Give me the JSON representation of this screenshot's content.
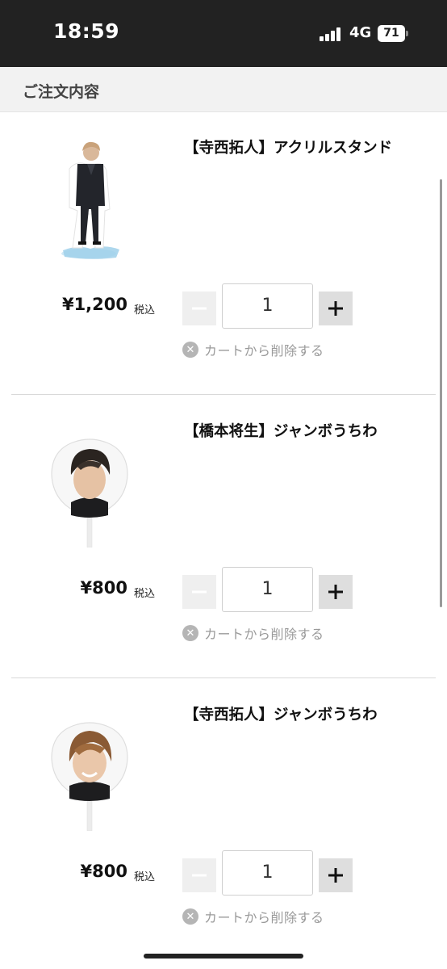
{
  "status_bar": {
    "time": "18:59",
    "network": "4G",
    "battery": "71",
    "icons": [
      "signal-icon",
      "battery-icon"
    ]
  },
  "header": {
    "title": "ご注文内容"
  },
  "items": [
    {
      "name": "【寺西拓人】アクリルスタンド",
      "price": "¥1,200",
      "tax_label": "税込",
      "quantity": "1",
      "remove_label": "カートから削除する",
      "image": "acrylic-stand-figure"
    },
    {
      "name": "【橋本将生】ジャンボうちわ",
      "price": "¥800",
      "tax_label": "税込",
      "quantity": "1",
      "remove_label": "カートから削除する",
      "image": "jumbo-uchiwa-fan"
    },
    {
      "name": "【寺西拓人】ジャンボうちわ",
      "price": "¥800",
      "tax_label": "税込",
      "quantity": "1",
      "remove_label": "カートから削除する",
      "image": "jumbo-uchiwa-fan"
    }
  ],
  "icons": {
    "minus": "minus-icon",
    "plus": "plus-icon",
    "remove": "close-circle-icon"
  },
  "colors": {
    "status_bar_bg": "#222222",
    "header_bg": "#f2f2f2",
    "remove_text": "#9a9a9a",
    "minus_bg": "#efefef",
    "plus_bg": "#dedede"
  }
}
